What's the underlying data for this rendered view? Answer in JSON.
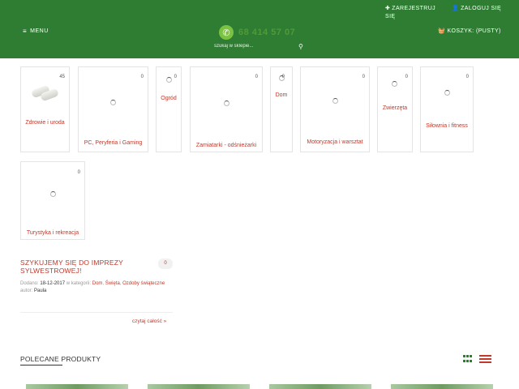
{
  "header": {
    "menu_label": "MENU",
    "register_label": "ZAREJESTRUJ SIĘ",
    "login_label": "ZALOGUJ SIĘ",
    "phone": "68 414 57 07",
    "search_placeholder": "szukaj w sklepie...",
    "cart_label": "KOSZYK: (PUSTY)"
  },
  "categories": [
    {
      "name": "Zdrowie i uroda",
      "count": "45"
    },
    {
      "name": "PC, Peryferia i Gaming",
      "count": "0"
    },
    {
      "name": "Ogród",
      "count": "0"
    },
    {
      "name": "Zamiatarki - odśnieżarki",
      "count": "0"
    },
    {
      "name": "Dom",
      "count": "0"
    },
    {
      "name": "Motoryzacja i warsztat",
      "count": "0"
    },
    {
      "name": "Zwierzęta",
      "count": "0"
    },
    {
      "name": "Siłownia i fitness",
      "count": "0"
    },
    {
      "name": "Turystyka i rekreacja",
      "count": "0"
    }
  ],
  "post": {
    "title": "SZYKUJEMY SIĘ DO IMPREZY SYLWESTROWEJ!",
    "comments": "0",
    "added_label": "Dodano:",
    "date": "18-12-2017",
    "category_label": "w kategorii:",
    "categories": [
      "Dom",
      "Święta",
      "Ozdoby świąteczne"
    ],
    "author_label": "autor:",
    "author": "Paula",
    "read_more": "czytaj całość »"
  },
  "recommended": {
    "title": "POLECANE PRODUKTY"
  },
  "colors": {
    "header_bg": "#2e7d32",
    "accent_red": "#c0392b",
    "phone_green": "#7cc242"
  }
}
